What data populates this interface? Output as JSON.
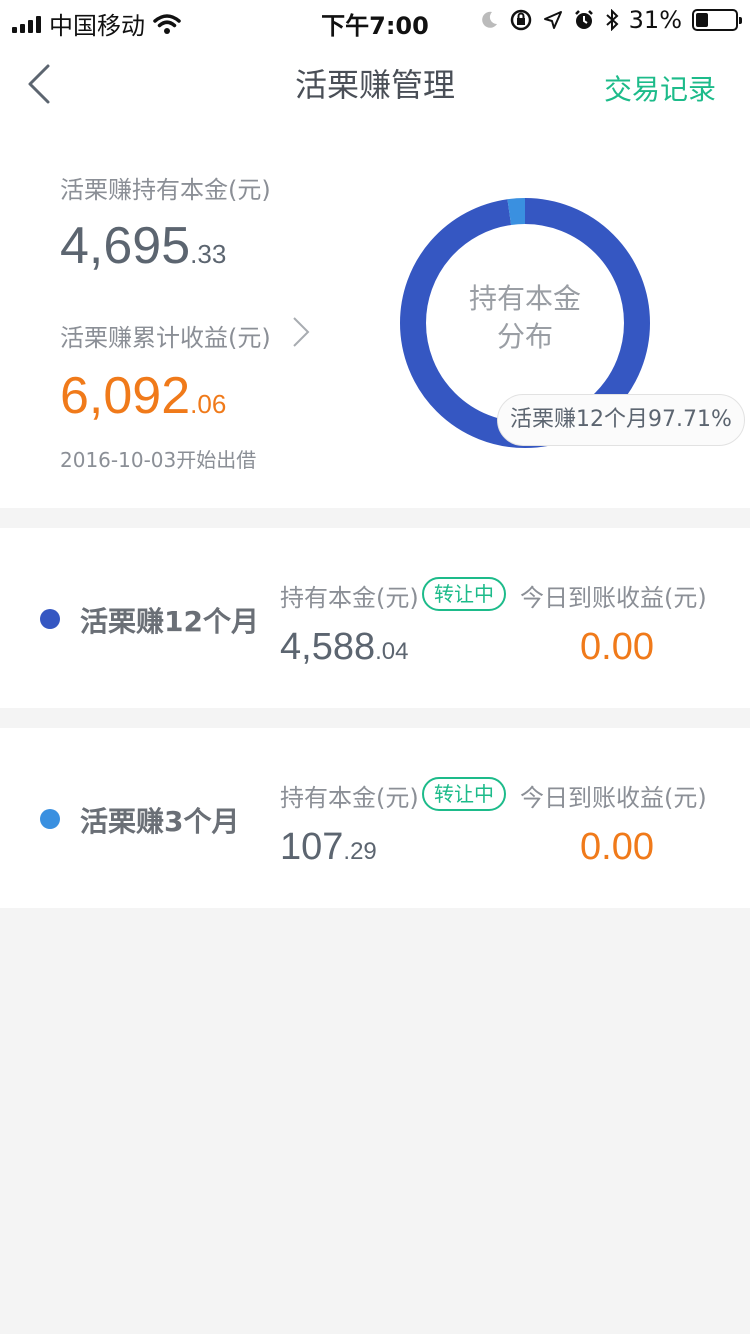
{
  "status_bar": {
    "carrier": "中国移动",
    "time": "下午7:00",
    "battery_percent": "31%",
    "battery_level": 0.31
  },
  "nav": {
    "title": "活栗赚管理",
    "right_link": "交易记录"
  },
  "summary": {
    "principal_label": "活栗赚持有本金(元)",
    "principal_int": "4,695",
    "principal_dec": ".33",
    "earnings_label": "活栗赚累计收益(元)",
    "earnings_int": "6,092",
    "earnings_dec": ".06",
    "start_date": "2016-10-03开始出借"
  },
  "donut": {
    "center_line1": "持有本金",
    "center_line2": "分布",
    "tooltip": "活栗赚12个月97.71%",
    "segments": [
      {
        "name": "活栗赚12个月",
        "percent": 97.71,
        "color": "#3557c2"
      },
      {
        "name": "活栗赚3个月",
        "percent": 2.29,
        "color": "#3a90e0"
      }
    ]
  },
  "products": [
    {
      "name": "活栗赚12个月",
      "dot_color": "#3557c2",
      "principal_label": "持有本金(元)",
      "badge": "转让中",
      "today_label": "今日到账收益(元)",
      "principal_int": "4,588",
      "principal_dec": ".04",
      "today_value": "0.00"
    },
    {
      "name": "活栗赚3个月",
      "dot_color": "#3a90e0",
      "principal_label": "持有本金(元)",
      "badge": "转让中",
      "today_label": "今日到账收益(元)",
      "principal_int": "107",
      "principal_dec": ".29",
      "today_value": "0.00"
    }
  ],
  "colors": {
    "accent_green": "#1dbb8a",
    "orange": "#f07a1a",
    "text_dark": "#5c6570"
  }
}
